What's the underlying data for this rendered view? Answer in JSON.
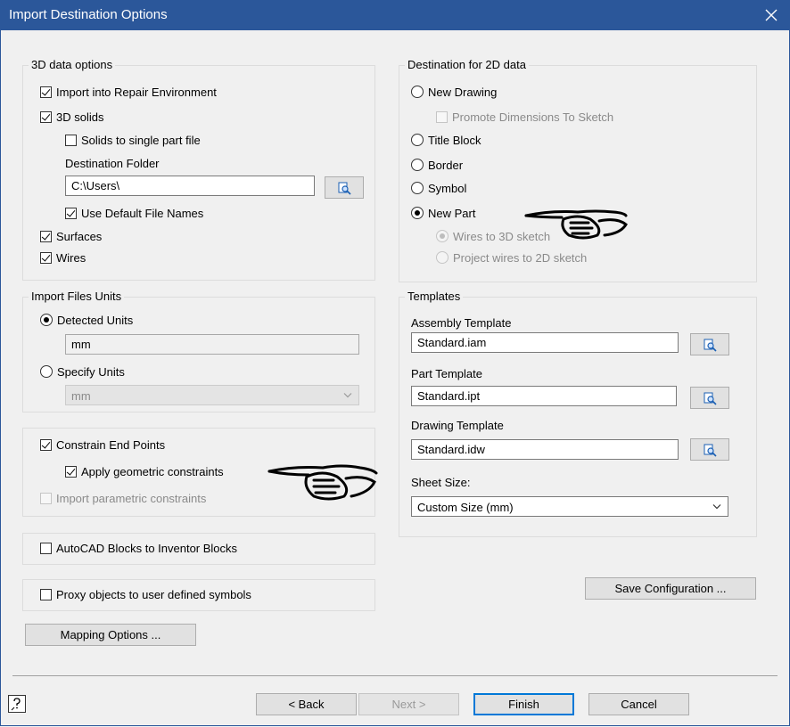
{
  "window": {
    "title": "Import Destination Options"
  },
  "group_3d": {
    "title": "3D data options",
    "import_repair": "Import into Repair Environment",
    "solids": "3D solids",
    "solids_single_part": "Solids to single part file",
    "dest_folder_label": "Destination Folder",
    "dest_folder_value": "C:\\Users\\",
    "use_default_names": "Use Default File Names",
    "surfaces": "Surfaces",
    "wires": "Wires"
  },
  "group_2d": {
    "title": "Destination for 2D data",
    "new_drawing": "New Drawing",
    "promote_dims": "Promote Dimensions To Sketch",
    "title_block": "Title Block",
    "border": "Border",
    "symbol": "Symbol",
    "new_part": "New Part",
    "wires_3d": "Wires to 3D sketch",
    "project_wires_2d": "Project wires to 2D sketch"
  },
  "units": {
    "title": "Import Files Units",
    "detected": "Detected Units",
    "detected_value": "mm",
    "specify": "Specify Units",
    "specify_value": "mm"
  },
  "constraints": {
    "constrain_end_points": "Constrain End Points",
    "apply_geometric": "Apply geometric constraints",
    "import_parametric": "Import parametric constraints"
  },
  "autocad_blocks": "AutoCAD Blocks to Inventor Blocks",
  "proxy_objects": "Proxy objects to user defined symbols",
  "mapping_button": "Mapping Options ...",
  "templates": {
    "title": "Templates",
    "assembly_label": "Assembly Template",
    "assembly_value": "Standard.iam",
    "part_label": "Part Template",
    "part_value": "Standard.ipt",
    "drawing_label": "Drawing Template",
    "drawing_value": "Standard.idw",
    "sheet_size_label": "Sheet Size:",
    "sheet_size_value": "Custom Size (mm)"
  },
  "save_config_button": "Save Configuration ...",
  "footer": {
    "back": "< Back",
    "next": "Next >",
    "finish": "Finish",
    "cancel": "Cancel"
  },
  "colors": {
    "titlebar": "#2b579a",
    "default_button_border": "#0078d7"
  },
  "icons": [
    "close-icon",
    "browse-folder-icon",
    "help-icon",
    "chevron-down-icon",
    "pointing-hand-scribble"
  ]
}
